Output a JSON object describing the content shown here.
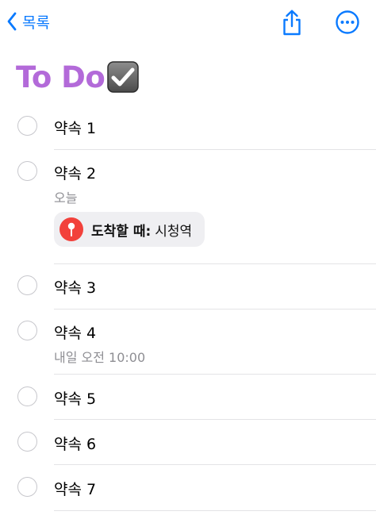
{
  "nav": {
    "back_label": "목록",
    "share_icon": "share-icon",
    "more_icon": "ellipsis-circle-icon"
  },
  "list": {
    "title": "To Do",
    "title_emoji": "check-box-icon"
  },
  "colors": {
    "accent": "#0a7aff",
    "title": "#b36ad9",
    "location_pin": "#f2413b",
    "secondary_text": "#8e8e93"
  },
  "items": [
    {
      "title": "약속 1"
    },
    {
      "title": "약속 2",
      "subtitle": "오늘",
      "location_label": "도착할 때:",
      "location_value": "시청역"
    },
    {
      "title": "약속 3"
    },
    {
      "title": "약속 4",
      "subtitle": "내일 오전 10:00"
    },
    {
      "title": "약속 5"
    },
    {
      "title": "약속 6"
    },
    {
      "title": "약속 7"
    }
  ]
}
